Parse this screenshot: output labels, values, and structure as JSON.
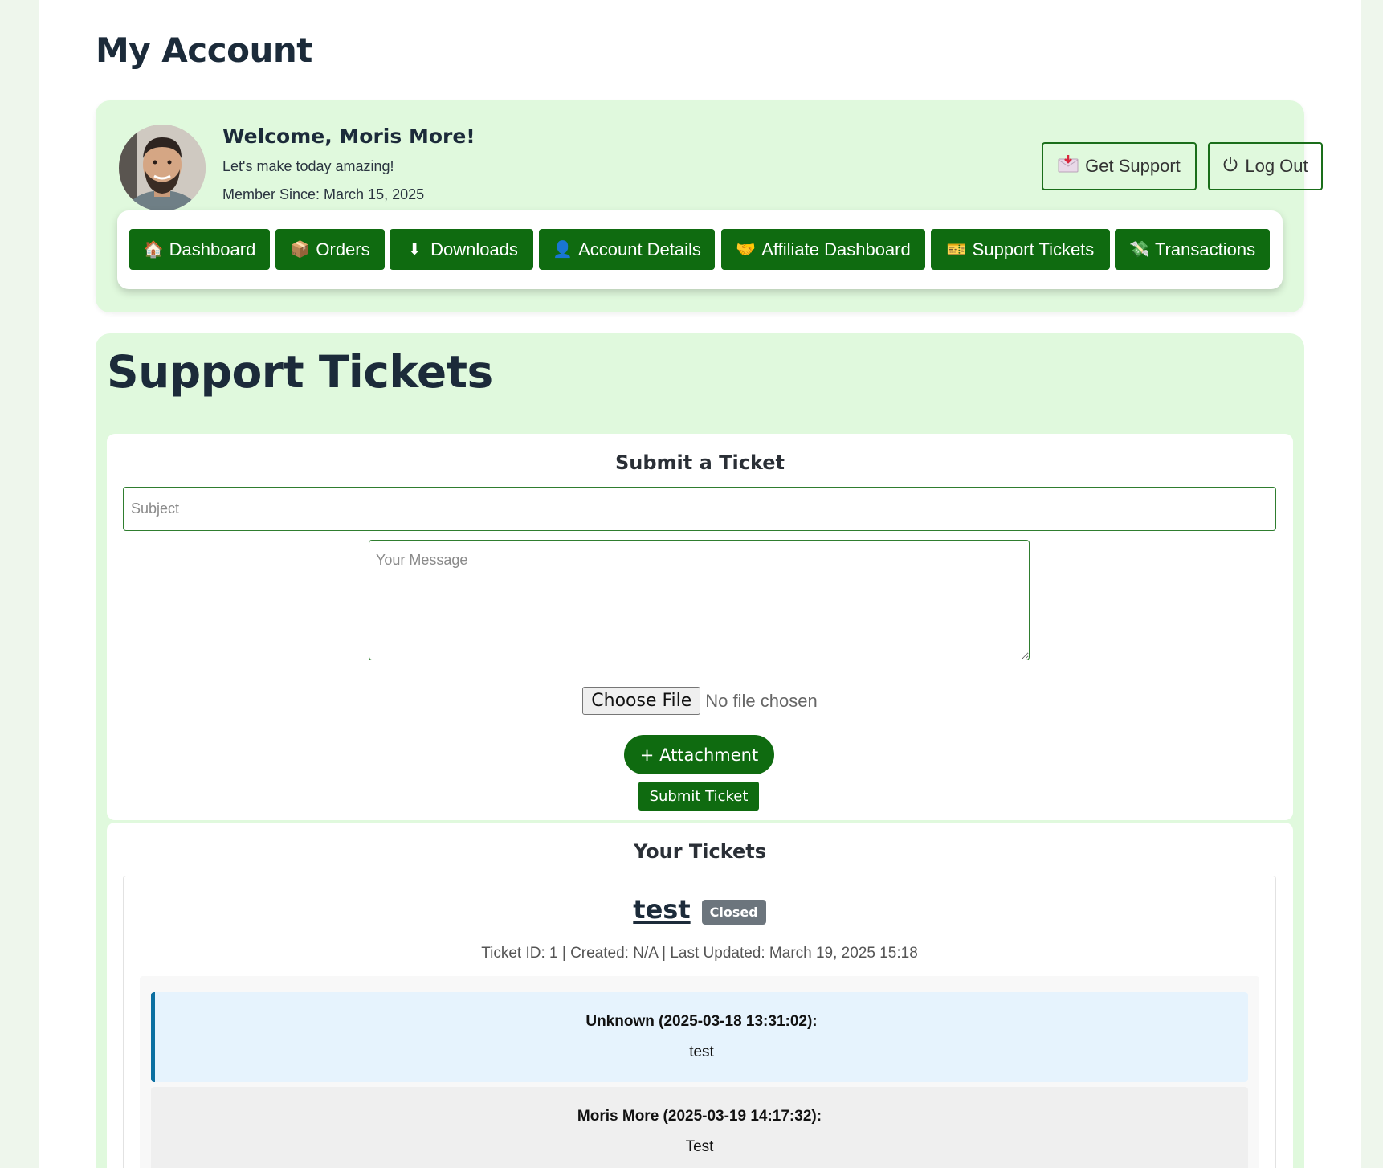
{
  "page": {
    "title": "My Account"
  },
  "header": {
    "welcome": "Welcome, Moris More!",
    "tagline": "Let's make today amazing!",
    "member_since": "Member Since: March 15, 2025",
    "get_support_label": "Get Support",
    "logout_label": "Log Out"
  },
  "nav": {
    "items": [
      {
        "label": "Dashboard",
        "icon": "house-icon"
      },
      {
        "label": "Orders",
        "icon": "package-icon"
      },
      {
        "label": "Downloads",
        "icon": "download-arrow-icon"
      },
      {
        "label": "Account Details",
        "icon": "user-silhouette-icon"
      },
      {
        "label": "Affiliate Dashboard",
        "icon": "handshake-icon"
      },
      {
        "label": "Support Tickets",
        "icon": "ticket-icon"
      },
      {
        "label": "Transactions",
        "icon": "money-icon"
      }
    ]
  },
  "support": {
    "title": "Support Tickets",
    "submit_heading": "Submit a Ticket",
    "subject_placeholder": "Subject",
    "message_placeholder": "Your Message",
    "choose_file_label": "Choose File",
    "no_file_text": "No file chosen",
    "attachment_label": "+ Attachment",
    "submit_label": "Submit Ticket",
    "your_tickets_heading": "Your Tickets"
  },
  "ticket": {
    "title": "test",
    "status": "Closed",
    "meta": "Ticket ID: 1 | Created: N/A | Last Updated: March 19, 2025 15:18",
    "messages": [
      {
        "author": "Unknown (2025-03-18 13:31:02):",
        "text": "test"
      },
      {
        "author": "Moris More (2025-03-19 14:17:32):",
        "text": "Test"
      }
    ]
  },
  "colors": {
    "accent": "#0f6b10",
    "card_bg": "#e0f9dd",
    "status_closed": "#6c757d",
    "message_highlight": "#e6f3fd",
    "message_border": "#0b6fa1"
  }
}
